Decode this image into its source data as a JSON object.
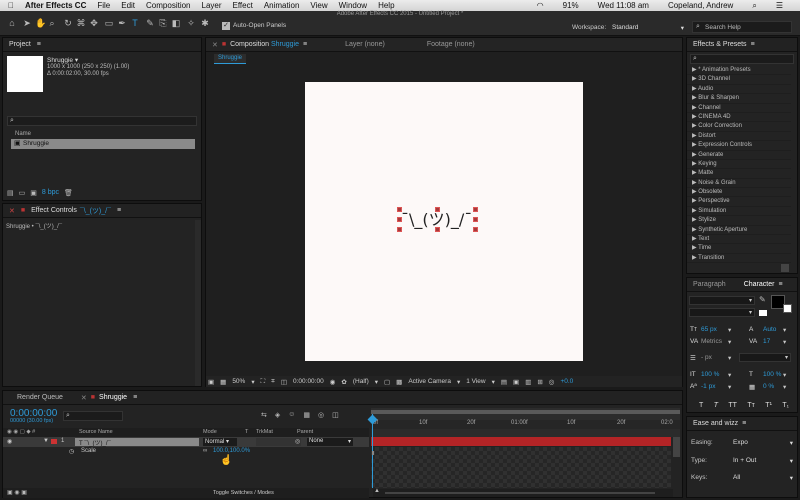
{
  "menubar": {
    "apple": "",
    "app_name": "After Effects CC",
    "items": [
      "File",
      "Edit",
      "Composition",
      "Layer",
      "Effect",
      "Animation",
      "View",
      "Window",
      "Help"
    ],
    "battery": "91%",
    "datetime": "Wed 11:08 am",
    "user": "Copeland, Andrew"
  },
  "toolbar": {
    "auto_open_label": "Auto-Open Panels",
    "window_title": "Adobe After Effects CC 2015 - Untitled Project *",
    "workspace_label": "Workspace:",
    "workspace_value": "Standard",
    "search_help": "Search Help"
  },
  "project": {
    "title": "Project",
    "item_name": "Shruggie ▾",
    "item_info1": "1000 x 1000  (250 x 250) (1.00)",
    "item_info2": "Δ 0:00:02:00, 30.00 fps",
    "search_placeholder": "",
    "col_name": "Name",
    "row_name": "Shruggie",
    "bpc": "8 bpc"
  },
  "effect_controls": {
    "title": "Effect Controls",
    "layer_name": "¯\\_(ツ)_/¯",
    "breadcrumb": "Shruggie • ¯\\_(ツ)_/¯"
  },
  "composition": {
    "tab_prefix": "Composition",
    "tab_name": "Shruggie",
    "layer_tab": "Layer (none)",
    "footage_tab": "Footage (none)",
    "sub_tab": "Shruggie",
    "canvas_text": "¯\\_(ツ)_/¯",
    "zoom": "50%",
    "timecode": "0:00:00:00",
    "resolution": "(Half)",
    "camera": "Active Camera",
    "views": "1 View",
    "exposure": "+0.0"
  },
  "effects_presets": {
    "title": "Effects & Presets",
    "items": [
      "▶ * Animation Presets",
      "▶ 3D Channel",
      "▶ Audio",
      "▶ Blur & Sharpen",
      "▶ Channel",
      "▶ CINEMA 4D",
      "▶ Color Correction",
      "▶ Distort",
      "▶ Expression Controls",
      "▶ Generate",
      "▶ Keying",
      "▶ Matte",
      "▶ Noise & Grain",
      "▶ Obsolete",
      "▶ Perspective",
      "▶ Simulation",
      "▶ Stylize",
      "▶ Synthetic Aperture",
      "▶ Text",
      "▶ Time",
      "▶ Transition"
    ]
  },
  "character": {
    "tab_paragraph": "Paragraph",
    "tab_character": "Character",
    "font_size": "65 px",
    "leading": "Auto",
    "kerning": "Metrics",
    "tracking": "17",
    "stroke_width": "- px",
    "vscale": "100 %",
    "hscale": "100 %",
    "baseline": "-1 px",
    "tsume": "0 %",
    "style_buttons": [
      "T",
      "T",
      "TT",
      "Tт",
      "T¹",
      "T₁"
    ]
  },
  "ease": {
    "title": "Ease and wizz",
    "easing_label": "Easing:",
    "easing_value": "Expo",
    "type_label": "Type:",
    "type_value": "In + Out",
    "keys_label": "Keys:",
    "keys_value": "All"
  },
  "timeline": {
    "tab_render": "Render Queue",
    "tab_comp": "Shruggie",
    "timecode": "0:00:00:00",
    "frames": "00000 (30.00 fps)",
    "col_source": "Source Name",
    "col_mode": "Mode",
    "col_t": "T",
    "col_trkmat": "TrkMat",
    "col_parent": "Parent",
    "layer_num": "1",
    "layer_name": "¯\\_(ツ)_/¯",
    "layer_mode": "Normal",
    "layer_parent": "None",
    "prop_name": "Scale",
    "prop_value": "100.0,100.0%",
    "ruler_labels": [
      "0f",
      "10f",
      "20f",
      "01:00f",
      "10f",
      "20f",
      "02:0"
    ],
    "toggle_label": "Toggle Switches / Modes"
  }
}
